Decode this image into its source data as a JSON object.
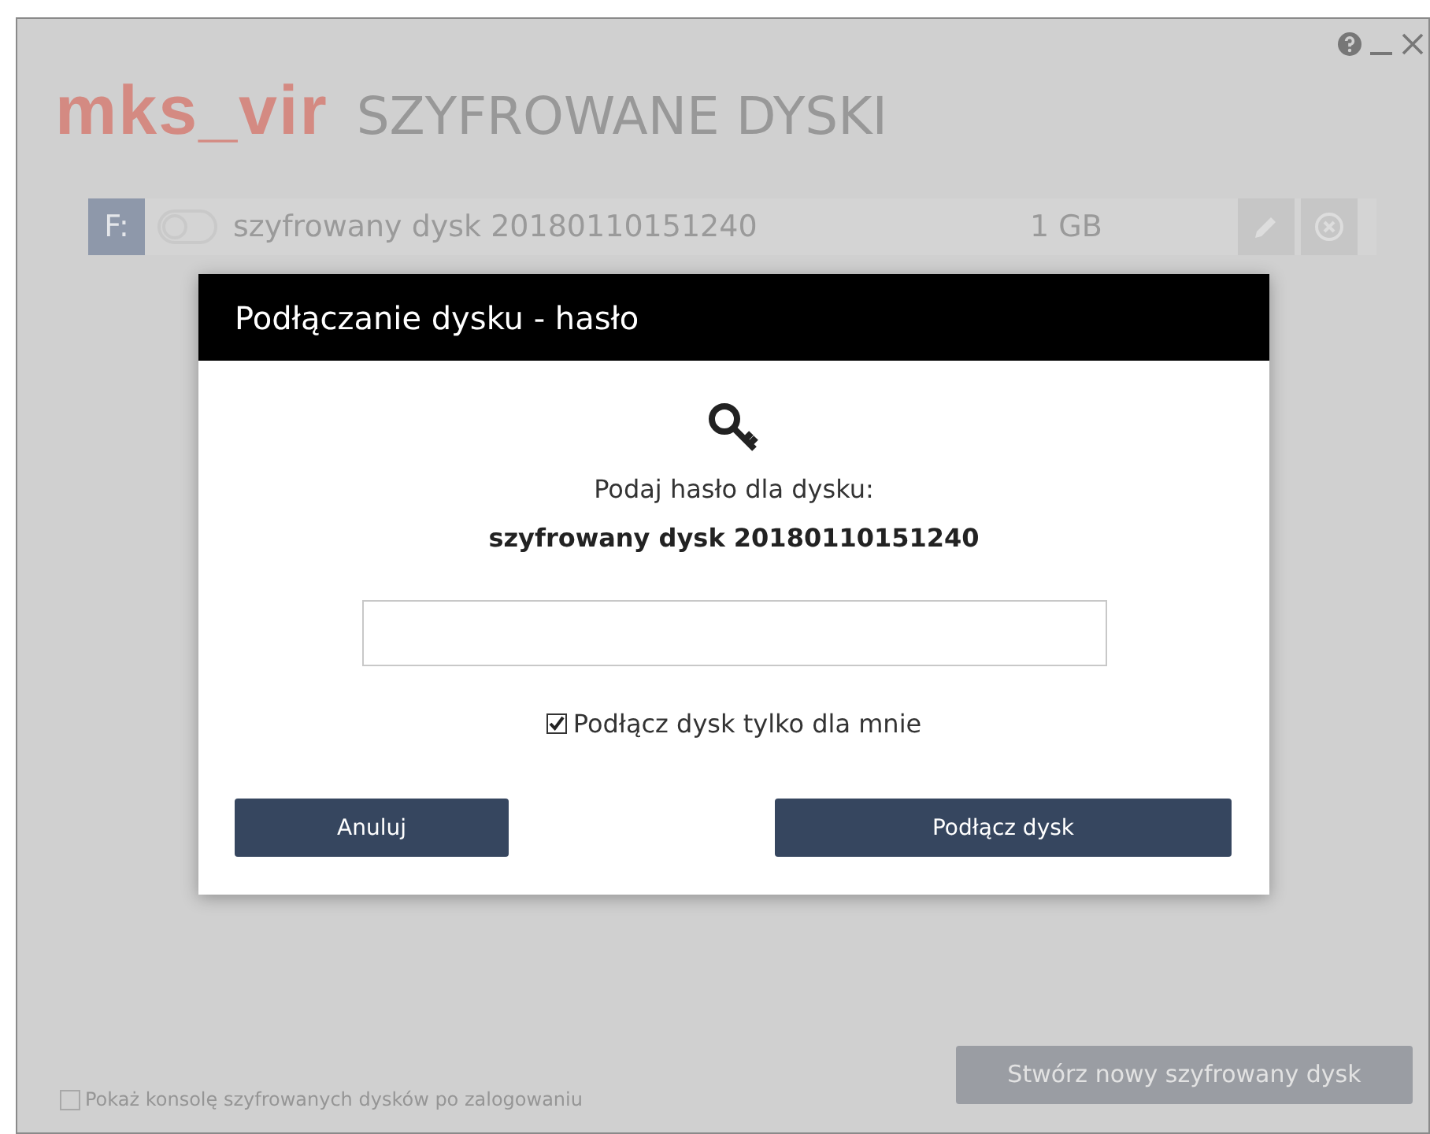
{
  "app": {
    "logo": "mks_vir",
    "title": "SZYFROWANE DYSKI"
  },
  "drives": [
    {
      "letter": "F:",
      "mounted": false,
      "name": "szyfrowany dysk 20180110151240",
      "size": "1 GB"
    }
  ],
  "dialog": {
    "title": "Podłączanie dysku - hasło",
    "prompt": "Podaj hasło dla dysku:",
    "disk_name": "szyfrowany dysk 20180110151240",
    "only_me": {
      "label": "Podłącz dysk tylko dla mnie",
      "checked": true
    },
    "buttons": [
      {
        "label": "Anuluj",
        "kind": "cancel"
      },
      {
        "label": "Podłącz dysk",
        "kind": "primary"
      }
    ]
  },
  "footer": {
    "show_console": {
      "label": "Pokaż konsolę szyfrowanych dysków po zalogowaniu",
      "checked": false
    },
    "create_button": "Stwórz nowy szyfrowany dysk"
  }
}
